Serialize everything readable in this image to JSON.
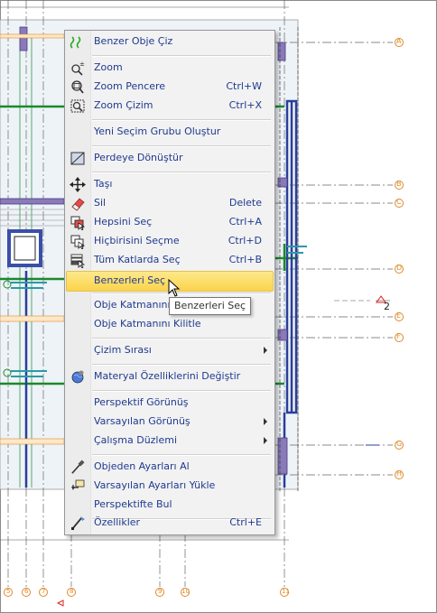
{
  "menu": {
    "items": [
      {
        "label": "Benzer Obje Çiz",
        "shortcut": "",
        "icon": "draw-similar-icon"
      },
      {
        "label": "Zoom",
        "shortcut": "",
        "icon": "zoom-icon"
      },
      {
        "label": "Zoom Pencere",
        "shortcut": "Ctrl+W",
        "icon": "zoom-window-icon"
      },
      {
        "label": "Zoom Çizim",
        "shortcut": "Ctrl+X",
        "icon": "zoom-drawing-icon"
      },
      {
        "label": "Yeni Seçim Grubu Oluştur",
        "shortcut": "",
        "icon": ""
      },
      {
        "label": "Perdeye Dönüştür",
        "shortcut": "",
        "icon": "convert-to-wall-icon"
      },
      {
        "label": "Taşı",
        "shortcut": "",
        "icon": "move-icon"
      },
      {
        "label": "Sil",
        "shortcut": "Delete",
        "icon": "eraser-icon"
      },
      {
        "label": "Hepsini Seç",
        "shortcut": "Ctrl+A",
        "icon": "select-all-icon"
      },
      {
        "label": "Hiçbirisini Seçme",
        "shortcut": "Ctrl+D",
        "icon": "select-none-icon"
      },
      {
        "label": "Tüm Katlarda Seç",
        "shortcut": "Ctrl+B",
        "icon": "select-all-floors-icon"
      },
      {
        "label": "Benzerleri Seç",
        "shortcut": "",
        "icon": ""
      },
      {
        "label": "Obje Katmanını Kapat",
        "shortcut": "",
        "icon": ""
      },
      {
        "label": "Obje Katmanını Kilitle",
        "shortcut": "",
        "icon": ""
      },
      {
        "label": "Çizim Sırası",
        "shortcut": "",
        "icon": "",
        "submenu": true
      },
      {
        "label": "Materyal Özelliklerini Değiştir",
        "shortcut": "",
        "icon": "material-globe-icon"
      },
      {
        "label": "Perspektif Görünüş",
        "shortcut": "",
        "icon": ""
      },
      {
        "label": "Varsayılan Görünüş",
        "shortcut": "",
        "icon": "",
        "submenu": true
      },
      {
        "label": "Çalışma Düzlemi",
        "shortcut": "",
        "icon": "",
        "submenu": true
      },
      {
        "label": "Objeden Ayarları Al",
        "shortcut": "",
        "icon": "eyedropper-icon"
      },
      {
        "label": "Varsayılan Ayarları Yükle",
        "shortcut": "",
        "icon": "load-defaults-icon"
      },
      {
        "label": "Perspektifte Bul",
        "shortcut": "",
        "icon": ""
      },
      {
        "label": "Özellikler",
        "shortcut": "Ctrl+E",
        "icon": "properties-icon"
      }
    ],
    "highlighted": "Benzerleri Seç"
  },
  "tooltip": "Benzerleri Seç",
  "drawing": {
    "axis_labels_right": [
      "A",
      "B",
      "C",
      "D",
      "E",
      "F",
      "G",
      "H"
    ],
    "axis_labels_bottom": [
      "5",
      "6",
      "7",
      "8",
      "9",
      "10",
      "11"
    ],
    "dimension_label": "2",
    "colors": {
      "green": "#1a8a2a",
      "blue": "#2a3f9a",
      "orange": "#e08a2a",
      "red": "#d22",
      "cyan": "#2a9aa8"
    }
  }
}
